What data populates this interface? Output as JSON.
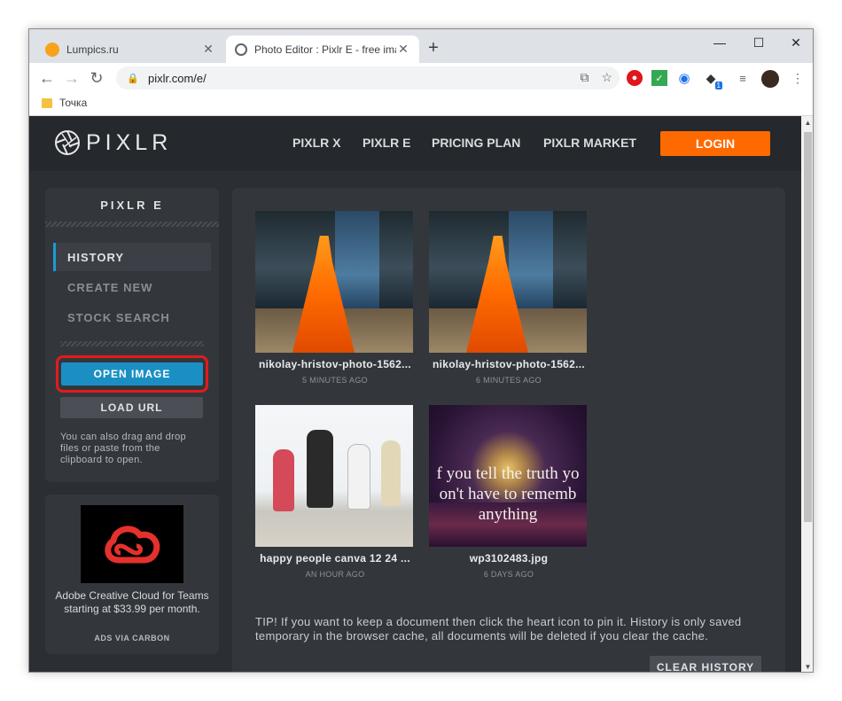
{
  "browser": {
    "tabs": [
      {
        "title": "Lumpics.ru",
        "active": false
      },
      {
        "title": "Photo Editor : Pixlr E - free image",
        "active": true
      }
    ],
    "address": "pixlr.com/e/",
    "bookmark": "Точка",
    "extension_badge": "1"
  },
  "header": {
    "logo": "PIXLR",
    "nav": [
      "PIXLR X",
      "PIXLR E",
      "PRICING PLAN",
      "PIXLR MARKET"
    ],
    "login": "LOGIN"
  },
  "sidebar": {
    "title": "PIXLR E",
    "items": [
      {
        "label": "HISTORY",
        "active": true
      },
      {
        "label": "CREATE NEW",
        "active": false
      },
      {
        "label": "STOCK SEARCH",
        "active": false
      }
    ],
    "open_image": "OPEN IMAGE",
    "load_url": "LOAD URL",
    "drag_note": "You can also drag and drop files or paste from the clipboard to open."
  },
  "ad": {
    "text": "Adobe Creative Cloud for Teams starting at $33.99 per month.",
    "via": "ADS VIA CARBON"
  },
  "history": [
    {
      "name": "nikolay-hristov-photo-1562...",
      "time": "5 MINUTES AGO"
    },
    {
      "name": "nikolay-hristov-photo-1562...",
      "time": "6 MINUTES AGO"
    },
    {
      "name": "happy people canva 12 24 ...",
      "time": "AN HOUR AGO"
    },
    {
      "name": "wp3102483.jpg",
      "time": "6 DAYS AGO",
      "overlay_text": [
        "f you tell the truth yo",
        "on't have to rememb",
        "anything"
      ]
    }
  ],
  "tip": "TIP! If you want to keep a document then click the heart icon to pin it. History is only saved temporary in the browser cache, all documents will be deleted if you clear the cache.",
  "clear_history": "CLEAR HISTORY",
  "colors": {
    "accent_orange": "#ff6a00",
    "accent_blue": "#1b8fc4",
    "highlight_red": "#e31b1b"
  }
}
